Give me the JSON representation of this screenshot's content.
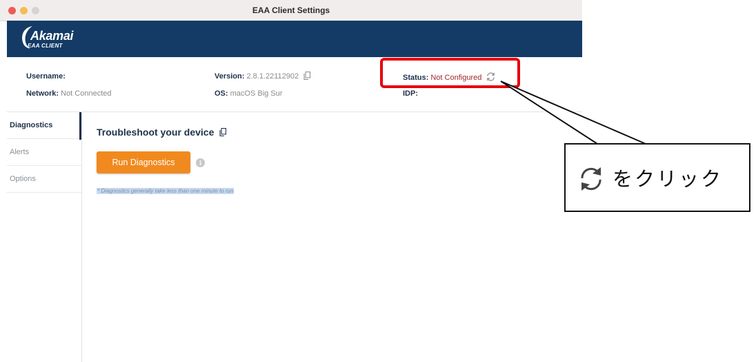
{
  "window": {
    "title": "EAA Client Settings"
  },
  "brand": {
    "name": "Akamai",
    "sub": "EAA CLIENT"
  },
  "info": {
    "username_label": "Username:",
    "username_value": "",
    "network_label": "Network:",
    "network_value": "Not Connected",
    "version_label": "Version:",
    "version_value": "2.8.1.22112902",
    "os_label": "OS:",
    "os_value": "macOS Big Sur",
    "status_label": "Status:",
    "status_value": "Not Configured",
    "idp_label": "IDP:",
    "idp_value": ""
  },
  "sidebar": {
    "items": [
      {
        "label": "Diagnostics",
        "active": true
      },
      {
        "label": "Alerts",
        "active": false
      },
      {
        "label": "Options",
        "active": false
      }
    ]
  },
  "main": {
    "title": "Troubleshoot your device",
    "run_button": "Run Diagnostics",
    "note": "* Diagnostics generally take less than one minute to run"
  },
  "annotation": {
    "callout_text": "をクリック",
    "highlight_color": "#e5000a"
  },
  "colors": {
    "banner": "#133b66",
    "accent": "#f18a1e",
    "status_bad": "#a3282b"
  }
}
